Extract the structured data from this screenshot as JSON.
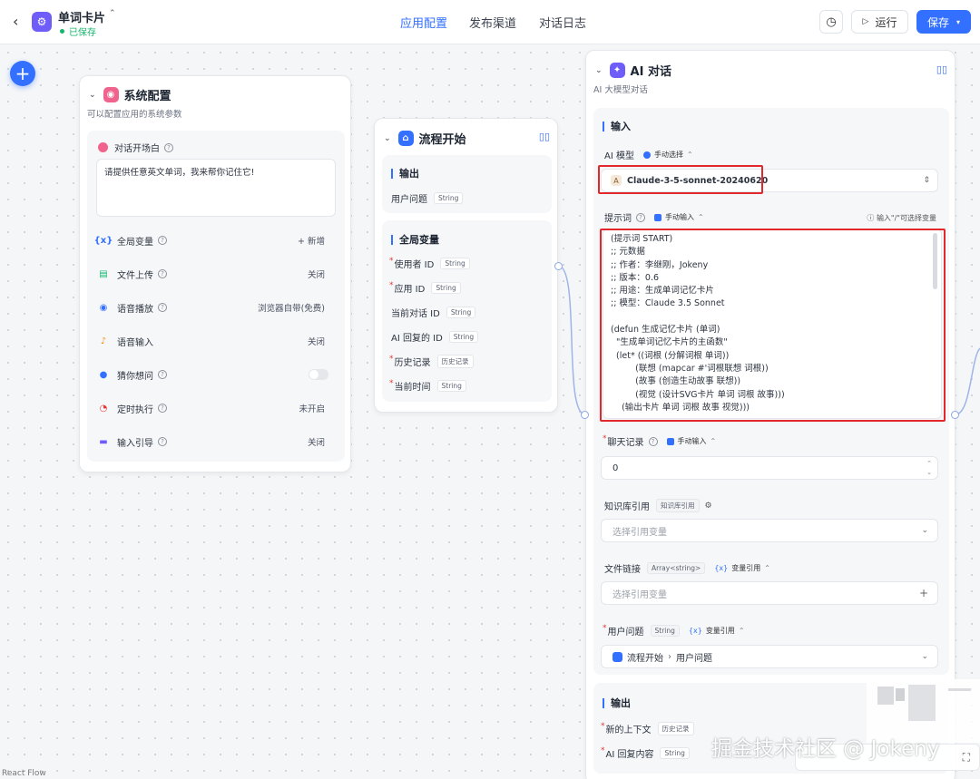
{
  "header": {
    "app_name": "单词卡片",
    "status": "已保存",
    "tabs": [
      "应用配置",
      "发布渠道",
      "对话日志"
    ],
    "run_label": "运行",
    "save_label": "保存",
    "accent": "#3370ff"
  },
  "system_node": {
    "title": "系统配置",
    "subtitle": "可以配置应用的系统参数",
    "opening_label": "对话开场白",
    "opening_text": "请提供任意英文单词，我来帮你记住它!",
    "rows": [
      {
        "icon": "variable-icon",
        "label": "全局变量",
        "value": "+ 新增"
      },
      {
        "icon": "file-upload-icon",
        "label": "文件上传",
        "value": "关闭"
      },
      {
        "icon": "voice-play-icon",
        "label": "语音播放",
        "value": "浏览器自带(免费)"
      },
      {
        "icon": "microphone-icon",
        "label": "语音输入",
        "value": "关闭"
      },
      {
        "icon": "lightbulb-icon",
        "label": "猜你想问",
        "value": ""
      },
      {
        "icon": "timer-icon",
        "label": "定时执行",
        "value": "未开启"
      },
      {
        "icon": "guide-icon",
        "label": "输入引导",
        "value": "关闭"
      }
    ]
  },
  "flow_node": {
    "title": "流程开始",
    "output_section": "输出",
    "output_var": {
      "label": "用户问题",
      "type": "String"
    },
    "global_section": "全局变量",
    "globals": [
      {
        "label": "使用者 ID",
        "type": "String",
        "required": true
      },
      {
        "label": "应用 ID",
        "type": "String",
        "required": true
      },
      {
        "label": "当前对话 ID",
        "type": "String",
        "required": false
      },
      {
        "label": "AI 回复的 ID",
        "type": "String",
        "required": false
      },
      {
        "label": "历史记录",
        "type": "历史记录",
        "required": true
      },
      {
        "label": "当前时间",
        "type": "String",
        "required": true
      }
    ]
  },
  "ai_node": {
    "title": "AI 对话",
    "subtitle": "AI 大模型对话",
    "input_section": "输入",
    "model_label": "AI 模型",
    "model_mode": "手动选择",
    "model_value": "Claude-3-5-sonnet-20240620",
    "prompt_label": "提示词",
    "prompt_mode": "手动输入",
    "prompt_hint": "输入\"/\"可选择变量",
    "prompt_lines": [
      "(提示词 START)",
      ";; 元数据",
      ";; 作者：李继刚，Jokeny",
      ";; 版本：0.6",
      ";; 用途：生成单词记忆卡片",
      ";; 模型：Claude 3.5 Sonnet",
      "",
      "(defun 生成记忆卡片 (单词)",
      "  \"生成单词记忆卡片的主函数\"",
      "  (let* ((词根 (分解词根 单词))",
      "         (联想 (mapcar #'词根联想 词根))",
      "         (故事 (创造生动故事 联想))",
      "         (视觉 (设计SVG卡片 单词 词根 故事)))",
      "    (输出卡片 单词 词根 故事 视觉)))"
    ],
    "history_label": "聊天记录",
    "history_mode": "手动输入",
    "history_value": "0",
    "kb_label": "知识库引用",
    "kb_tag": "知识库引用",
    "kb_placeholder": "选择引用变量",
    "file_label": "文件链接",
    "file_type": "Array<string>",
    "file_mode": "变量引用",
    "file_placeholder": "选择引用变量",
    "user_q_label": "用户问题",
    "user_q_type": "String",
    "user_q_mode": "变量引用",
    "user_q_source": "流程开始",
    "user_q_var": "用户问题",
    "output_section": "输出",
    "outputs": [
      {
        "label": "新的上下文",
        "type": "历史记录"
      },
      {
        "label": "AI 回复内容",
        "type": "String"
      }
    ]
  },
  "watermark": "掘金技术社区 @ Jokeny",
  "footer": "React Flow"
}
